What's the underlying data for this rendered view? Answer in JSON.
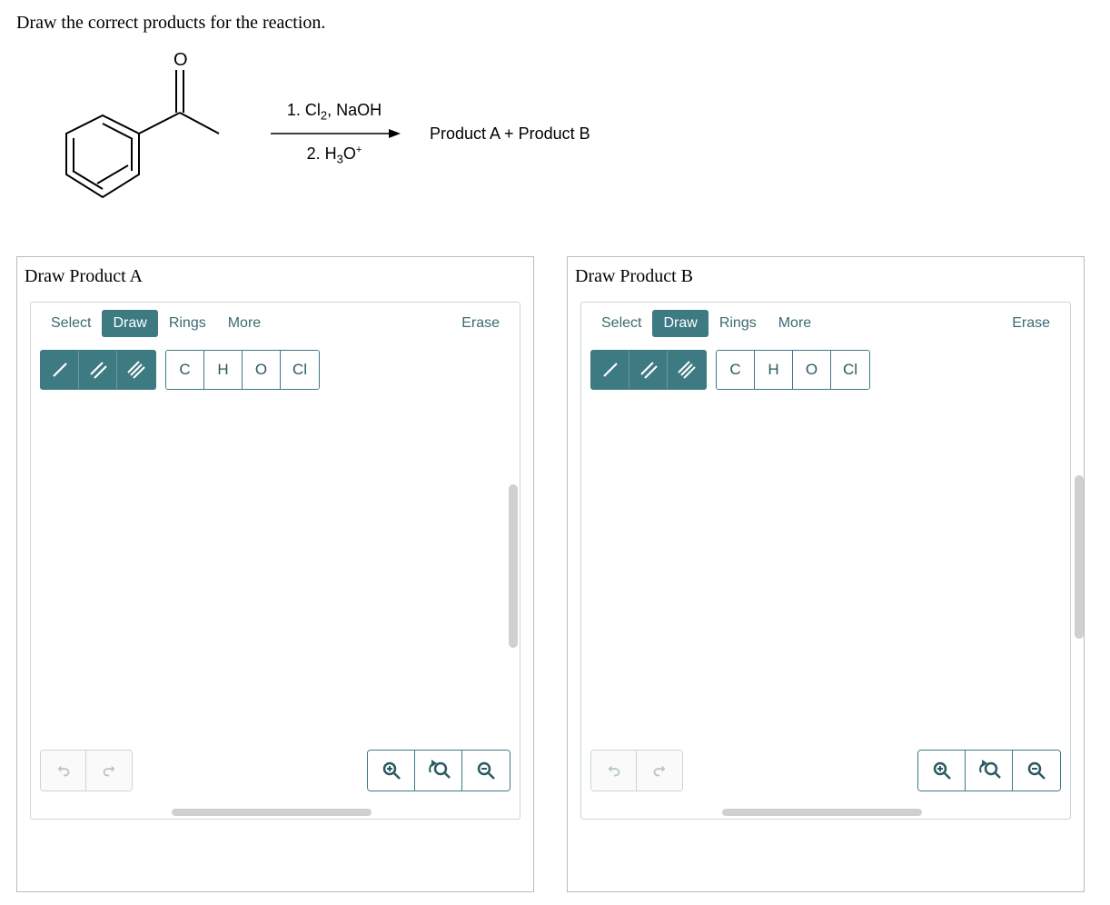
{
  "question": "Draw the correct products for the reaction.",
  "reagents": {
    "step1": "1. Cl₂, NaOH",
    "step2": "2. H₃O⁺"
  },
  "products_label": "Product A  +  Product B",
  "panels": [
    {
      "title": "Draw Product A",
      "modes": [
        "Select",
        "Draw",
        "Rings",
        "More"
      ],
      "active_mode": "Draw",
      "erase": "Erase",
      "elements": [
        "C",
        "H",
        "O",
        "Cl"
      ]
    },
    {
      "title": "Draw Product B",
      "modes": [
        "Select",
        "Draw",
        "Rings",
        "More"
      ],
      "active_mode": "Draw",
      "erase": "Erase",
      "elements": [
        "C",
        "H",
        "O",
        "Cl"
      ]
    }
  ]
}
